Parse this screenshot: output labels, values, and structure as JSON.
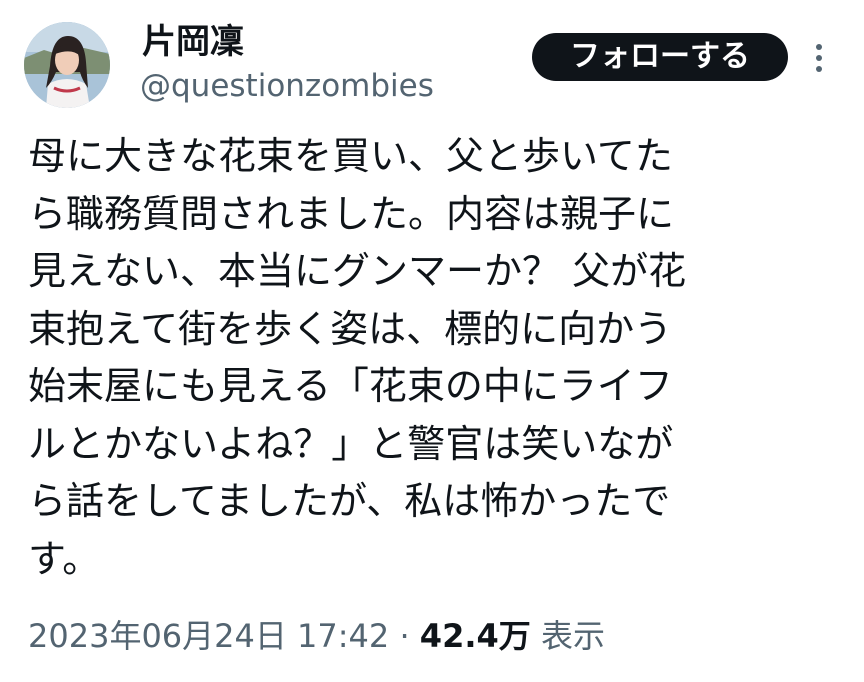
{
  "user": {
    "display_name": "片岡凜",
    "handle": "@questionzombies",
    "avatar_icon": "profile-photo"
  },
  "actions": {
    "follow_label": "フォローする",
    "more_icon": "more-vertical-icon"
  },
  "tweet": {
    "lines": [
      "母に大きな花束を買い、父と歩いてた",
      "ら職務質問されました。内容は親子に",
      "見えない、本当にグンマーか？ 父が花",
      "束抱えて街を歩く姿は、標的に向かう",
      "始末屋にも見える「花束の中にライフ",
      "ルとかないよね？」と警官は笑いなが",
      "ら話をしてましたが、私は怖かったで",
      "す。"
    ]
  },
  "meta": {
    "timestamp": "2023年06月24日 17:42",
    "separator": "·",
    "views_count": "42.4万",
    "views_label": "表示"
  },
  "colors": {
    "text_primary": "#0f1419",
    "text_secondary": "#536471",
    "button_bg": "#0f1419",
    "button_text": "#ffffff"
  }
}
